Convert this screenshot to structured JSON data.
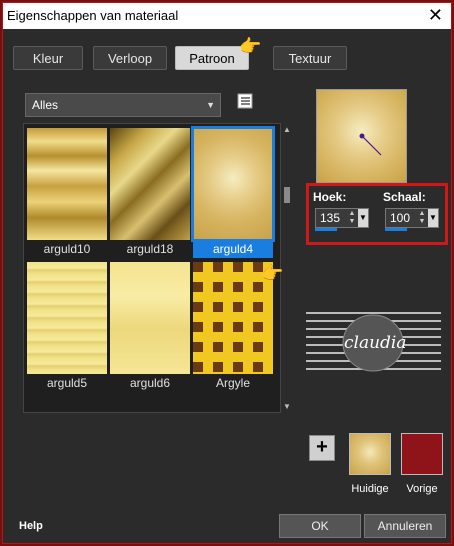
{
  "window": {
    "title": "Eigenschappen van materiaal",
    "close_glyph": "✕"
  },
  "tabs": [
    {
      "label": "Kleur",
      "active": false
    },
    {
      "label": "Verloop",
      "active": false
    },
    {
      "label": "Patroon",
      "active": true
    },
    {
      "label": "Textuur",
      "active": false
    }
  ],
  "category": {
    "value": "Alles",
    "arrow": "▼"
  },
  "patterns": [
    {
      "name": "arguld10",
      "selected": false
    },
    {
      "name": "arguld18",
      "selected": false
    },
    {
      "name": "arguld4",
      "selected": true
    },
    {
      "name": "arguld5",
      "selected": false
    },
    {
      "name": "arguld6",
      "selected": false
    },
    {
      "name": "Argyle",
      "selected": false
    }
  ],
  "angle": {
    "label": "Hoek:",
    "value": "135"
  },
  "scale": {
    "label": "Schaal:",
    "value": "100"
  },
  "watermark": {
    "text": "claudia"
  },
  "add_button": {
    "label": "+"
  },
  "current": {
    "label": "Huidige",
    "color": "#d6b45a"
  },
  "previous": {
    "label": "Vorige",
    "color": "#8e1419"
  },
  "help": {
    "label": "Help"
  },
  "ok": {
    "label": "OK"
  },
  "cancel": {
    "label": "Annuleren"
  },
  "colors": {
    "accent": "#1a7ee0",
    "highlight": "#d01818"
  }
}
